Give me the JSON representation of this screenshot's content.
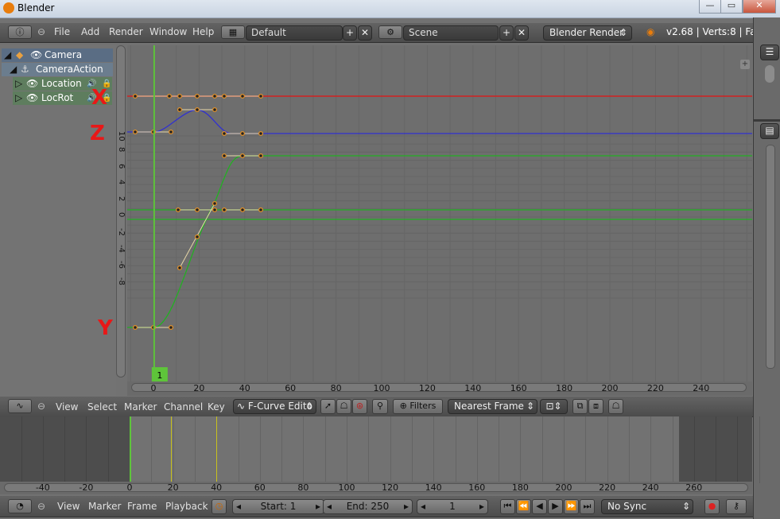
{
  "window": {
    "title": "Blender",
    "min": "—",
    "max": "▭",
    "close": "✕"
  },
  "info_header": {
    "menus": [
      "File",
      "Add",
      "Render",
      "Window",
      "Help"
    ],
    "screen": "Default",
    "scene": "Scene",
    "engine": "Blender Render",
    "stats": "v2.68 | Verts:8 | Faces:6 | T"
  },
  "channels": {
    "items": [
      {
        "label": "Camera"
      },
      {
        "label": "CameraAction"
      },
      {
        "label": "Location"
      },
      {
        "label": "LocRot"
      }
    ]
  },
  "annotations": {
    "x": "X",
    "z": "Z",
    "y": "Y"
  },
  "graph": {
    "y_ticks": [
      "10",
      "8",
      "6",
      "4",
      "2",
      "0",
      "-2",
      "-4",
      "-6",
      "-8"
    ],
    "x_ticks": [
      "0",
      "20",
      "40",
      "60",
      "80",
      "100",
      "120",
      "140",
      "160",
      "180",
      "200",
      "220",
      "240"
    ],
    "current_frame": "1",
    "colors": {
      "x_curve": "#d22020",
      "y_curve": "#22b022",
      "z_curve": "#3030d0",
      "playhead": "#5ec43a"
    }
  },
  "graph_header": {
    "menus": [
      "View",
      "Select",
      "Marker",
      "Channel",
      "Key"
    ],
    "mode": "F-Curve Edito",
    "filters": "Filters",
    "snap": "Nearest Frame"
  },
  "timeline": {
    "ticks": [
      "-40",
      "-20",
      "0",
      "20",
      "40",
      "60",
      "80",
      "100",
      "120",
      "140",
      "160",
      "180",
      "200",
      "220",
      "240",
      "260"
    ]
  },
  "timeline_header": {
    "menus": [
      "View",
      "Marker",
      "Frame",
      "Playback"
    ],
    "start": "Start: 1",
    "end": "End: 250",
    "frame": "1",
    "sync": "No Sync"
  }
}
